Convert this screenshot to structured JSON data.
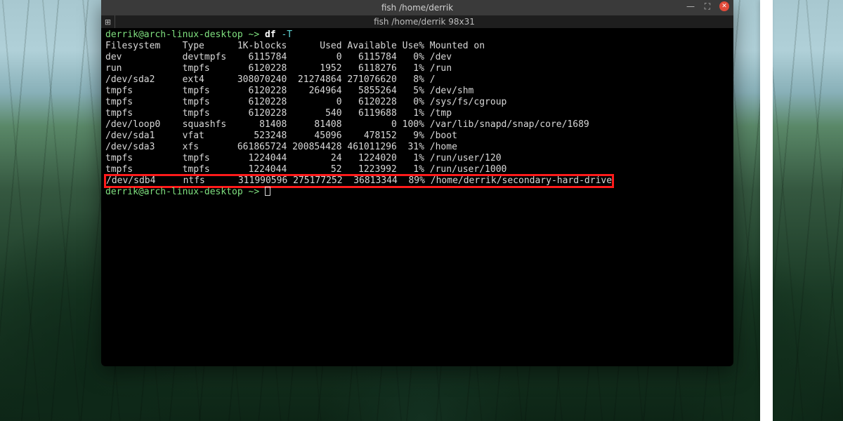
{
  "window": {
    "title": "fish  /home/derrik",
    "tab_title": "fish  /home/derrik 98x31",
    "tab_icon": "⊞",
    "controls": {
      "minimize": "—",
      "maximize": "⛶",
      "close": "✕"
    }
  },
  "prompt": {
    "user_host": "derrik@arch-linux-desktop",
    "sep": " ~> ",
    "command": "df",
    "flag": "-T"
  },
  "header": {
    "filesystem": "Filesystem",
    "type": "Type",
    "blocks": "1K-blocks",
    "used": "Used",
    "avail": "Available",
    "usep": "Use%",
    "mount": "Mounted on"
  },
  "rows": [
    {
      "fs": "dev",
      "type": "devtmpfs",
      "blocks": "6115784",
      "used": "0",
      "avail": "6115784",
      "usep": "0%",
      "mount": "/dev"
    },
    {
      "fs": "run",
      "type": "tmpfs",
      "blocks": "6120228",
      "used": "1952",
      "avail": "6118276",
      "usep": "1%",
      "mount": "/run"
    },
    {
      "fs": "/dev/sda2",
      "type": "ext4",
      "blocks": "308070240",
      "used": "21274864",
      "avail": "271076620",
      "usep": "8%",
      "mount": "/"
    },
    {
      "fs": "tmpfs",
      "type": "tmpfs",
      "blocks": "6120228",
      "used": "264964",
      "avail": "5855264",
      "usep": "5%",
      "mount": "/dev/shm"
    },
    {
      "fs": "tmpfs",
      "type": "tmpfs",
      "blocks": "6120228",
      "used": "0",
      "avail": "6120228",
      "usep": "0%",
      "mount": "/sys/fs/cgroup"
    },
    {
      "fs": "tmpfs",
      "type": "tmpfs",
      "blocks": "6120228",
      "used": "540",
      "avail": "6119688",
      "usep": "1%",
      "mount": "/tmp"
    },
    {
      "fs": "/dev/loop0",
      "type": "squashfs",
      "blocks": "81408",
      "used": "81408",
      "avail": "0",
      "usep": "100%",
      "mount": "/var/lib/snapd/snap/core/1689"
    },
    {
      "fs": "/dev/sda1",
      "type": "vfat",
      "blocks": "523248",
      "used": "45096",
      "avail": "478152",
      "usep": "9%",
      "mount": "/boot"
    },
    {
      "fs": "/dev/sda3",
      "type": "xfs",
      "blocks": "661865724",
      "used": "200854428",
      "avail": "461011296",
      "usep": "31%",
      "mount": "/home"
    },
    {
      "fs": "tmpfs",
      "type": "tmpfs",
      "blocks": "1224044",
      "used": "24",
      "avail": "1224020",
      "usep": "1%",
      "mount": "/run/user/120"
    },
    {
      "fs": "tmpfs",
      "type": "tmpfs",
      "blocks": "1224044",
      "used": "52",
      "avail": "1223992",
      "usep": "1%",
      "mount": "/run/user/1000"
    },
    {
      "fs": "/dev/sdb4",
      "type": "ntfs",
      "blocks": "311990596",
      "used": "275177252",
      "avail": "36813344",
      "usep": "89%",
      "mount": "/home/derrik/secondary-hard-drive",
      "highlight": true
    }
  ],
  "highlight_color": "#ff1a1a"
}
